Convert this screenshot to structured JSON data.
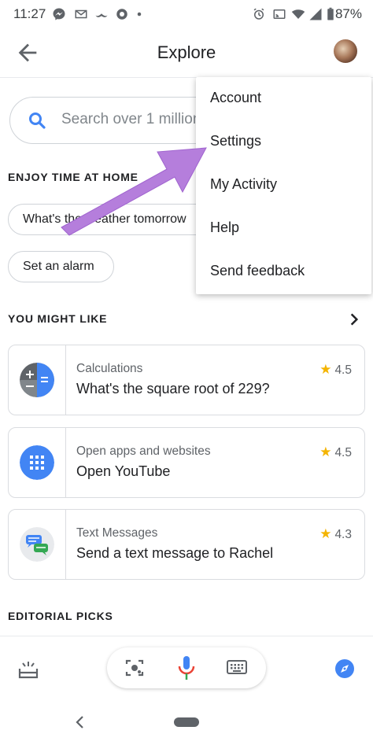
{
  "status_bar": {
    "time": "11:27",
    "battery": "87%"
  },
  "header": {
    "title": "Explore"
  },
  "search": {
    "placeholder": "Search over 1 million"
  },
  "sections": {
    "enjoy": "ENJOY TIME AT HOME",
    "you_might_like": "YOU MIGHT LIKE",
    "editorial": "EDITORIAL PICKS"
  },
  "chips": [
    {
      "label": "What's the weather tomorrow"
    },
    {
      "label": "Set an alarm"
    }
  ],
  "cards": [
    {
      "category": "Calculations",
      "title": "What's the square root of 229?",
      "rating": "4.5",
      "icon": "calculator-icon"
    },
    {
      "category": "Open apps and websites",
      "title": "Open YouTube",
      "rating": "4.5",
      "icon": "apps-grid-icon"
    },
    {
      "category": "Text Messages",
      "title": "Send a text message to Rachel",
      "rating": "4.3",
      "icon": "chat-bubbles-icon"
    }
  ],
  "menu": {
    "items": [
      {
        "label": "Account"
      },
      {
        "label": "Settings"
      },
      {
        "label": "My Activity"
      },
      {
        "label": "Help"
      },
      {
        "label": "Send feedback"
      }
    ]
  },
  "colors": {
    "accent": "#4285f4",
    "star": "#f4b400",
    "arrow": "#b57edc"
  }
}
